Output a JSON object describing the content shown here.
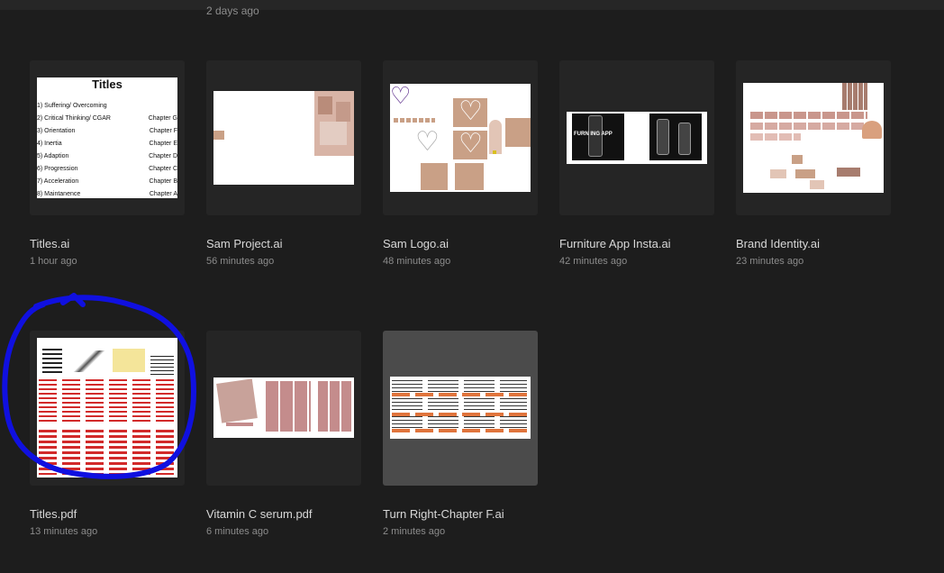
{
  "header": {
    "prev_time": "2 days ago"
  },
  "files": [
    {
      "name": "Titles.ai",
      "time": "1 hour ago"
    },
    {
      "name": "Sam Project.ai",
      "time": "56 minutes ago"
    },
    {
      "name": "Sam Logo.ai",
      "time": "48 minutes ago"
    },
    {
      "name": "Furniture App Insta.ai",
      "time": "42 minutes ago"
    },
    {
      "name": "Brand Identity.ai",
      "time": "23 minutes ago"
    },
    {
      "name": "Titles.pdf",
      "time": "13 minutes ago"
    },
    {
      "name": "Vitamin C serum.pdf",
      "time": "6 minutes ago"
    },
    {
      "name": "Turn Right-Chapter F.ai",
      "time": "2 minutes ago"
    }
  ],
  "titles_doc": {
    "title": "Titles",
    "lines": [
      "1) Suffering/ Overcoming",
      "2) Critical Thinking/ CGAR",
      "3) Orientation",
      "4) Inertia",
      "5) Adaption",
      "6) Progression",
      "7) Acceleration",
      "8) Maintanence"
    ],
    "chapters": [
      "Chapter G",
      "Chapter F",
      "Chapter E",
      "Chapter D",
      "Chapter C",
      "Chapter B",
      "Chapter A"
    ]
  },
  "furniture_thumb": {
    "text": "FURN ING APP"
  },
  "colors": {
    "background": "#1d1d1d",
    "card": "#252525",
    "card_selected": "#4b4b4b",
    "annotation": "#1010e0",
    "accent_tan": "#c9a086",
    "accent_pink": "#c48c8c",
    "accent_red": "#d22a2a"
  }
}
